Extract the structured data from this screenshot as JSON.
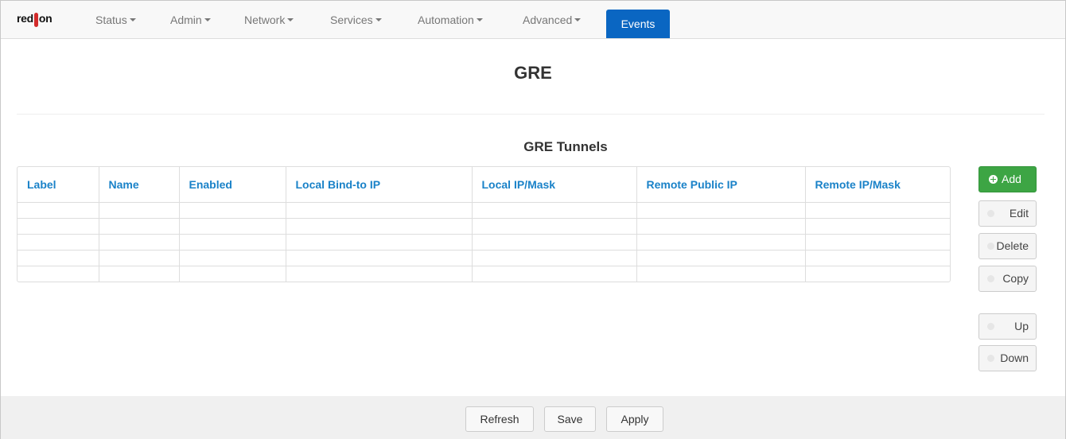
{
  "brand": {
    "logo_text_left": "red",
    "logo_text_right": "on"
  },
  "nav": {
    "items": [
      {
        "label": "Status"
      },
      {
        "label": "Admin"
      },
      {
        "label": "Network"
      },
      {
        "label": "Services"
      },
      {
        "label": "Automation"
      },
      {
        "label": "Advanced"
      }
    ],
    "events_label": "Events"
  },
  "page": {
    "title": "GRE",
    "section_title": "GRE Tunnels"
  },
  "table": {
    "columns": [
      "Label",
      "Name",
      "Enabled",
      "Local Bind-to IP",
      "Local IP/Mask",
      "Remote Public IP",
      "Remote IP/Mask"
    ],
    "rows": [
      [
        "",
        "",
        "",
        "",
        "",
        "",
        ""
      ],
      [
        "",
        "",
        "",
        "",
        "",
        "",
        ""
      ],
      [
        "",
        "",
        "",
        "",
        "",
        "",
        ""
      ],
      [
        "",
        "",
        "",
        "",
        "",
        "",
        ""
      ],
      [
        "",
        "",
        "",
        "",
        "",
        "",
        ""
      ]
    ]
  },
  "actions": {
    "add": "Add",
    "edit": "Edit",
    "delete": "Delete",
    "copy": "Copy",
    "up": "Up",
    "down": "Down"
  },
  "footer": {
    "refresh": "Refresh",
    "save": "Save",
    "apply": "Apply"
  },
  "colors": {
    "accent": "#0a66c2",
    "header_link": "#1a82c8",
    "add_button": "#3da544"
  }
}
